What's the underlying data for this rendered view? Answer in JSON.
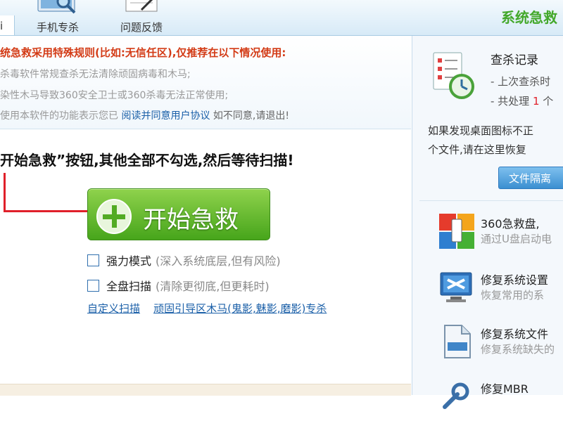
{
  "topbar": {
    "left_tab_fragment": "i",
    "tabs": [
      {
        "label": "手机专杀",
        "icon": "magnifier-icon"
      },
      {
        "label": "问题反馈",
        "icon": "feedback-icon"
      }
    ],
    "brand_fragment": "系统急救"
  },
  "notice": {
    "title": "统急救采用特殊规则(比如:无信任区),仅推荐在以下情况使用:",
    "line1": "杀毒软件常规查杀无法清除顽固病毒和木马;",
    "line2": "染性木马导致360安全卫士或360杀毒无法正常使用;",
    "line3_pre": "使用本软件的功能表示您已",
    "line3_link": "阅读并同意用户协议",
    "line3_post": "如不同意,请退出!"
  },
  "main": {
    "instruction": "开始急救”按钮,其他全部不勾选,然后等待扫描!",
    "start_button": "开始急救",
    "options": [
      {
        "label": "强力模式",
        "hint": "(深入系统底层,但有风险)",
        "checked": false
      },
      {
        "label": "全盘扫描",
        "hint": "(清除更彻底,但更耗时)",
        "checked": false
      }
    ],
    "links": [
      "自定义扫描",
      "顽固引导区木马(鬼影,魅影,磨影)专杀"
    ]
  },
  "right": {
    "record_title": "查杀记录",
    "last_scan": "- 上次查杀时",
    "processed_pre": "- 共处理",
    "processed_count": "1",
    "processed_post": "个",
    "desc_line1": "如果发现桌面图标不正",
    "desc_line2": "个文件,请在这里恢复",
    "quarantine_button": "文件隔离",
    "tools": [
      {
        "name": "360急救盘,",
        "desc": "通过U盘启动电",
        "icon": "rescue-disk-icon"
      },
      {
        "name": "修复系统设置",
        "desc": "恢复常用的系",
        "icon": "repair-settings-icon"
      },
      {
        "name": "修复系统文件",
        "desc": "修复系统缺失的",
        "icon": "dll-file-icon"
      },
      {
        "name": "修复MBR",
        "desc": "",
        "icon": "wrench-icon"
      }
    ]
  },
  "colors": {
    "accent_green": "#47a51b",
    "warning_red": "#d33b16",
    "link_blue": "#1a5fa8",
    "brand_green": "#43a82b"
  }
}
